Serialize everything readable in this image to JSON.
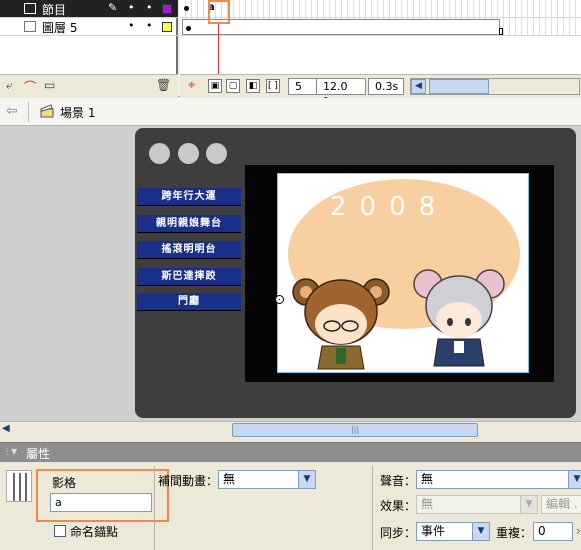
{
  "timeline": {
    "layers": [
      {
        "name": "節目",
        "color": "#9b1fd0",
        "selected": true
      },
      {
        "name": "圖層 5",
        "color": "#ffff40",
        "selected": false
      }
    ],
    "frame_label_marker": "a",
    "status": {
      "current_frame": "5",
      "fps": "12.0 fps",
      "time": "0.3s"
    }
  },
  "scene": {
    "label": "場景 1"
  },
  "stage": {
    "menu_buttons": [
      "跨年行大運",
      "親明親娘舞台",
      "搖滾明明台",
      "斯巴達摔跤",
      "門廳"
    ],
    "year_text": "2008"
  },
  "properties": {
    "title": "屬性",
    "frame_label": "影格",
    "frame_name_value": "a",
    "anchor_label": "命名錨點",
    "tween_label": "補間動畫：",
    "tween_value": "無",
    "sound_label": "聲音：",
    "sound_value": "無",
    "effect_label": "效果：",
    "effect_value": "無",
    "edit_label": "編輯 .",
    "sync_label": "同步：",
    "sync_value": "事件",
    "repeat_label": "重複：",
    "repeat_value": "0"
  },
  "colors": {
    "highlight": "#f08a4b",
    "stage_bg": "#3e3e3e",
    "menu_button": "#1a2f8a"
  }
}
